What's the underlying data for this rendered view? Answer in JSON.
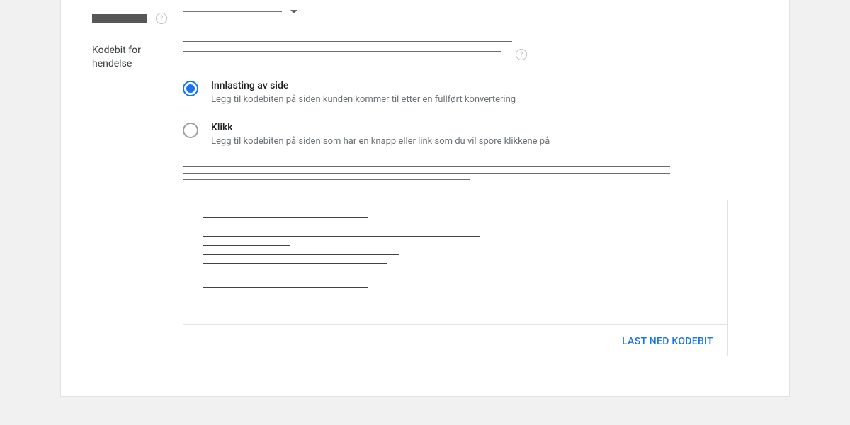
{
  "form": {
    "top_row": {
      "dropdown_placeholder": ""
    },
    "section_label": "Kodebit for hendelse",
    "radios": [
      {
        "selected": true,
        "title": "Innlasting av side",
        "desc": "Legg til kodebiten på siden kunden kommer til etter en fullført konvertering"
      },
      {
        "selected": false,
        "title": "Klikk",
        "desc": "Legg til kodebiten på siden som har en knapp eller link som du vil spore klikkene på"
      }
    ],
    "download_label": "LAST NED KODEBIT"
  }
}
